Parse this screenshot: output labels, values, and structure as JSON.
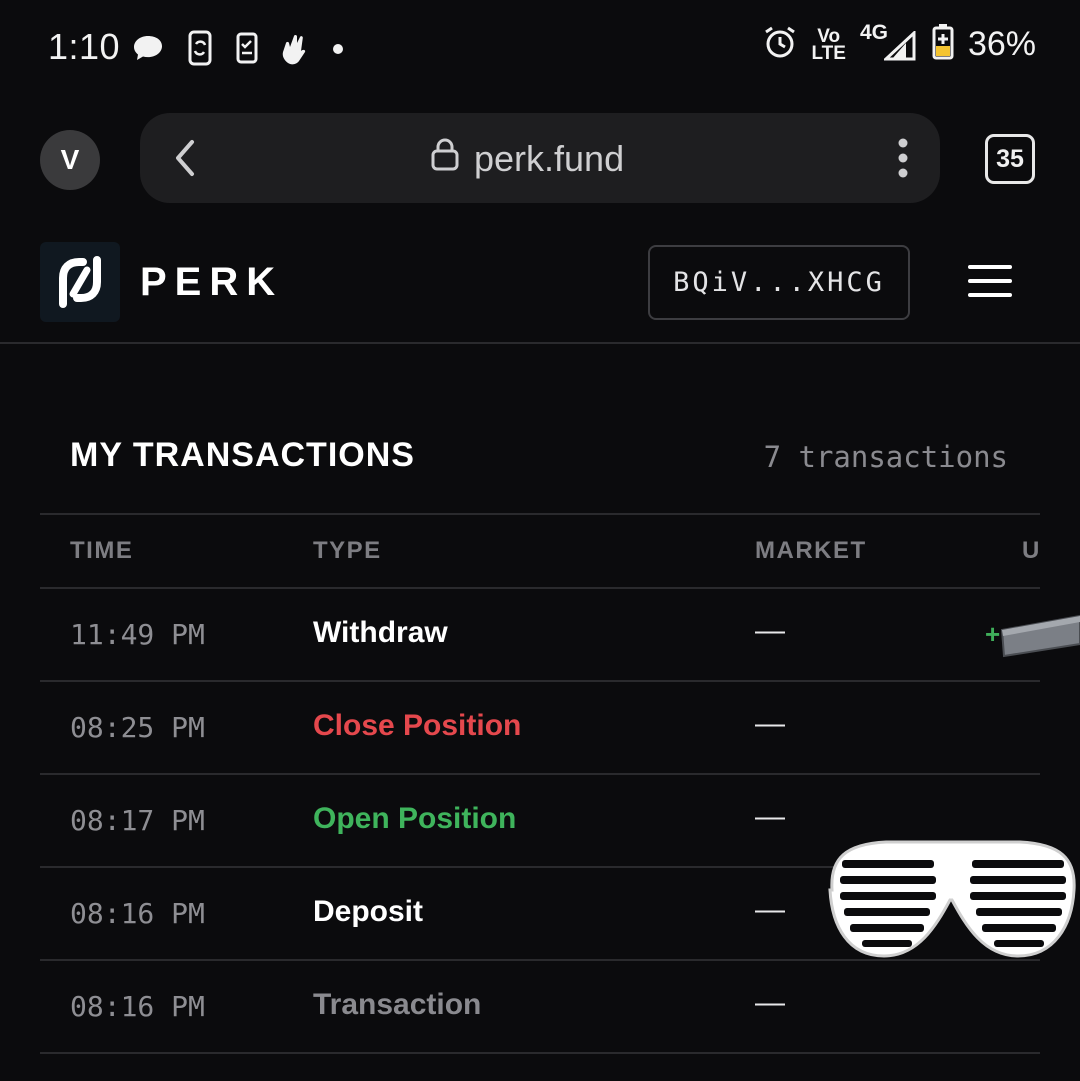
{
  "status_bar": {
    "time": "1:10",
    "battery": "36%",
    "network_top": "Vo",
    "network_bottom": "LTE",
    "signal_type": "4G",
    "icons_left": [
      "chat-bubble-icon",
      "phone-rotate-icon",
      "device-check-icon",
      "clap-hand-icon",
      "dot-icon"
    ],
    "icons_right": [
      "alarm-icon",
      "volte-icon",
      "signal-icon",
      "battery-charging-icon"
    ]
  },
  "browser": {
    "profile_initial": "V",
    "url": "perk.fund",
    "tab_count": "35"
  },
  "app": {
    "brand": "PERK",
    "wallet": "BQiV...XHCG"
  },
  "transactions": {
    "title": "MY TRANSACTIONS",
    "count_label": "7 transactions",
    "columns": [
      "TIME",
      "TYPE",
      "MARKET",
      "U"
    ],
    "rows": [
      {
        "time": "11:49 PM",
        "type": "Withdraw",
        "market": "—",
        "usd": "+",
        "type_color": "#ffffff"
      },
      {
        "time": "08:25 PM",
        "type": "Close Position",
        "market": "—",
        "usd": "",
        "type_color": "#e5484d"
      },
      {
        "time": "08:17 PM",
        "type": "Open Position",
        "market": "—",
        "usd": "",
        "type_color": "#3fb45c"
      },
      {
        "time": "08:16 PM",
        "type": "Deposit",
        "market": "—",
        "usd": "",
        "type_color": "#ffffff"
      },
      {
        "time": "08:16 PM",
        "type": "Transaction",
        "market": "—",
        "usd": "",
        "type_color": "#8a8a8f"
      }
    ]
  },
  "colors": {
    "background": "#0b0b0d",
    "positive": "#3fb45c",
    "negative": "#e5484d",
    "muted": "#8a8a8f"
  }
}
